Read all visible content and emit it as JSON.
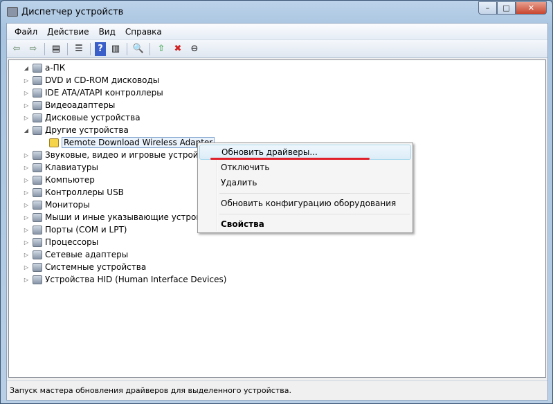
{
  "window": {
    "title": "Диспетчер устройств",
    "min": "–",
    "max": "□",
    "close": "✕"
  },
  "menu": [
    "Файл",
    "Действие",
    "Вид",
    "Справка"
  ],
  "tree": {
    "root": "а-ПК",
    "items": [
      {
        "label": "DVD и CD-ROM дисководы"
      },
      {
        "label": "IDE ATA/ATAPI контроллеры"
      },
      {
        "label": "Видеоадаптеры"
      },
      {
        "label": "Дисковые устройства"
      },
      {
        "label": "Другие устройства",
        "expanded": true,
        "children": [
          "Remote Download Wireless Adapter"
        ]
      },
      {
        "label": "Звуковые, видео и игровые устройства"
      },
      {
        "label": "Клавиатуры"
      },
      {
        "label": "Компьютер"
      },
      {
        "label": "Контроллеры USB"
      },
      {
        "label": "Мониторы"
      },
      {
        "label": "Мыши и иные указывающие устройства"
      },
      {
        "label": "Порты (COM и LPT)"
      },
      {
        "label": "Процессоры"
      },
      {
        "label": "Сетевые адаптеры"
      },
      {
        "label": "Системные устройства"
      },
      {
        "label": "Устройства HID (Human Interface Devices)"
      }
    ]
  },
  "context_menu": [
    "Обновить драйверы...",
    "Отключить",
    "Удалить",
    "Обновить конфигурацию оборудования",
    "Свойства"
  ],
  "status": "Запуск мастера обновления драйверов для выделенного устройства.",
  "colors": {
    "highlight_line": "#e0202a"
  }
}
